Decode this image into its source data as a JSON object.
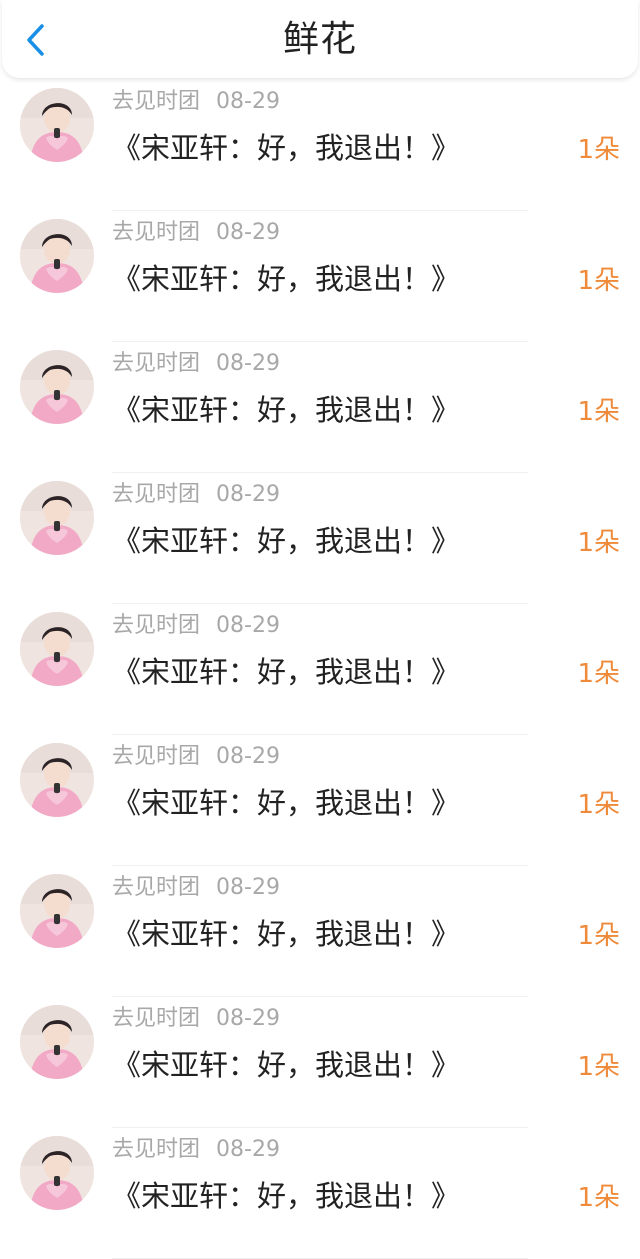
{
  "header": {
    "title": "鲜花",
    "back_icon": "chevron-left-icon",
    "accent_color": "#1a8fe6"
  },
  "colors": {
    "count": "#ee8a3a",
    "meta": "#a8a8a8",
    "message": "#222222"
  },
  "items": [
    {
      "user": "去见时团",
      "date": "08-29",
      "message": "《宋亚轩：好，我退出！》",
      "count": "1朵"
    },
    {
      "user": "去见时团",
      "date": "08-29",
      "message": "《宋亚轩：好，我退出！》",
      "count": "1朵"
    },
    {
      "user": "去见时团",
      "date": "08-29",
      "message": "《宋亚轩：好，我退出！》",
      "count": "1朵"
    },
    {
      "user": "去见时团",
      "date": "08-29",
      "message": "《宋亚轩：好，我退出！》",
      "count": "1朵"
    },
    {
      "user": "去见时团",
      "date": "08-29",
      "message": "《宋亚轩：好，我退出！》",
      "count": "1朵"
    },
    {
      "user": "去见时团",
      "date": "08-29",
      "message": "《宋亚轩：好，我退出！》",
      "count": "1朵"
    },
    {
      "user": "去见时团",
      "date": "08-29",
      "message": "《宋亚轩：好，我退出！》",
      "count": "1朵"
    },
    {
      "user": "去见时团",
      "date": "08-29",
      "message": "《宋亚轩：好，我退出！》",
      "count": "1朵"
    },
    {
      "user": "去见时团",
      "date": "08-29",
      "message": "《宋亚轩：好，我退出！》",
      "count": "1朵"
    }
  ]
}
